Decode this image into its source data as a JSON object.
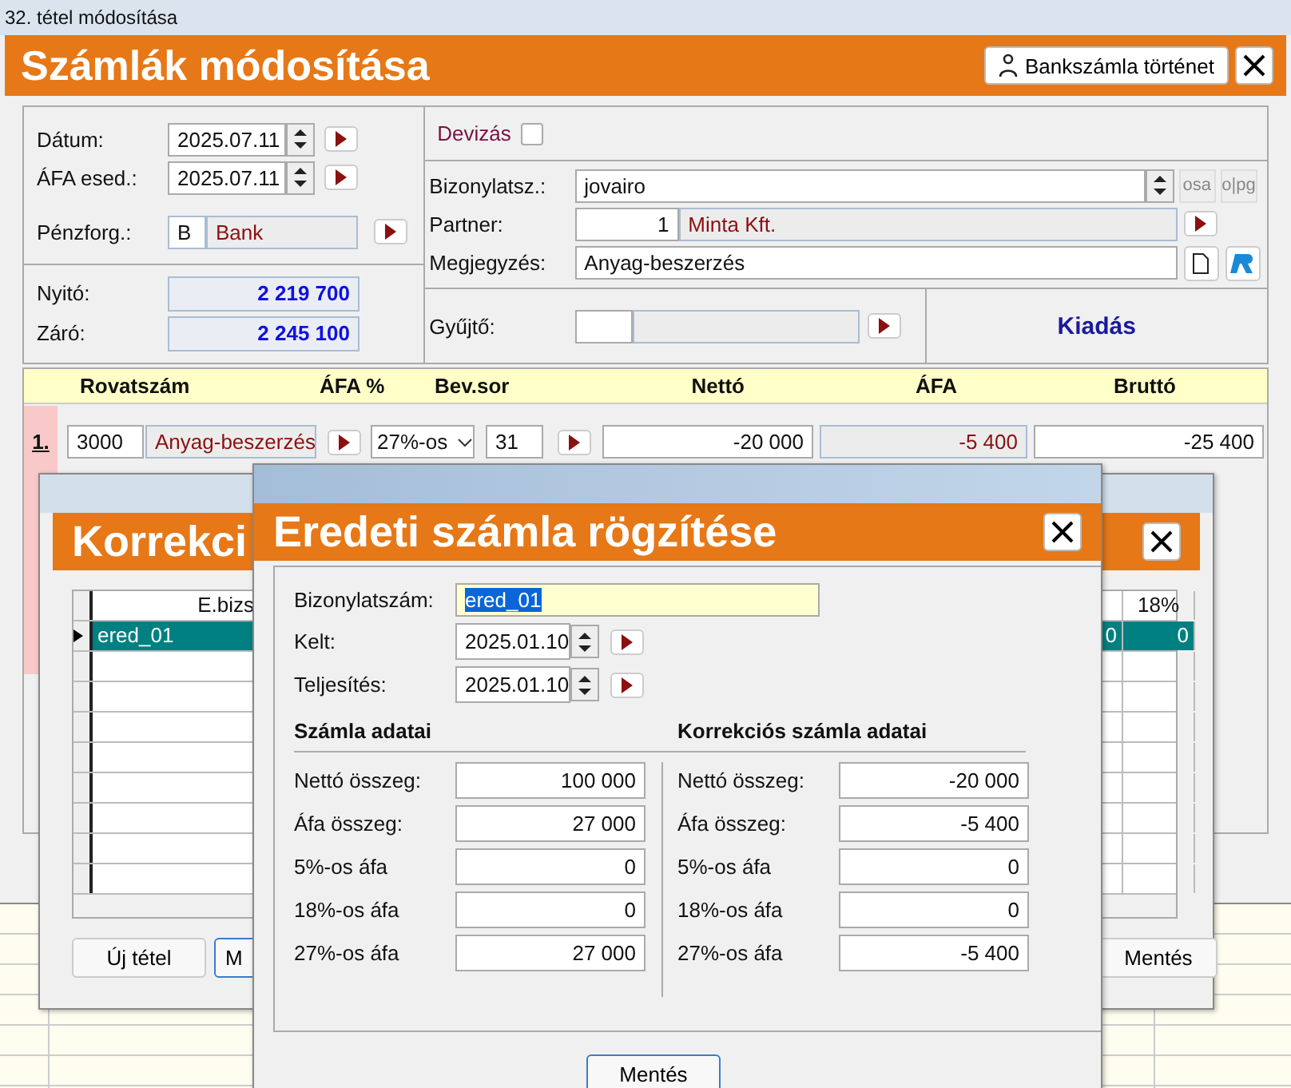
{
  "window": {
    "title": "32. tétel módosítása"
  },
  "header": {
    "title": "Számlák módosítása",
    "history_button": "Bankszámla történet"
  },
  "form": {
    "datum": {
      "label": "Dátum:",
      "value": "2025.07.11"
    },
    "afa_esed": {
      "label": "ÁFA esed.:",
      "value": "2025.07.11"
    },
    "penzforg": {
      "label": "Pénzforg.:",
      "code": "B",
      "name": "Bank"
    },
    "nyito": {
      "label": "Nyitó:",
      "value": "2 219 700"
    },
    "zaro": {
      "label": "Záró:",
      "value": "2 245 100"
    },
    "devizas": {
      "label": "Devizás",
      "checked": false
    },
    "bizonylatsz": {
      "label": "Bizonylatsz.:",
      "value": "jovairo",
      "side_buttons": [
        "osa",
        "o|pg"
      ]
    },
    "partner": {
      "label": "Partner:",
      "code": "1",
      "name": "Minta Kft."
    },
    "megjegyzes": {
      "label": "Megjegyzés:",
      "value": "Anyag-beszerzés"
    },
    "gyujto": {
      "label": "Gyűjtő:"
    },
    "direction": "Kiadás"
  },
  "table": {
    "columns": [
      "Rovatszám",
      "ÁFA %",
      "Bev.sor",
      "Nettó",
      "ÁFA",
      "Bruttó"
    ],
    "rows": [
      {
        "number": "1.",
        "rovat_code": "3000",
        "rovat_name": "Anyag-beszerzés",
        "afa_rate": "27%-os",
        "bev_sor": "31",
        "netto": "-20 000",
        "afa": "-5 400",
        "brutto": "-25 400"
      }
    ]
  },
  "correction_window": {
    "title": "Korrekci",
    "columns": [
      "E.bizs",
      "18%"
    ],
    "rows": [
      {
        "cells": [
          "ered_01",
          "0",
          "0"
        ],
        "selected": true
      }
    ],
    "buttons": [
      "Új tétel",
      "M",
      "Mentés"
    ]
  },
  "dialog": {
    "title": "Eredeti számla rögzítése",
    "bizonylatszam": {
      "label": "Bizonylatszám:",
      "value": "ered_01"
    },
    "kelt": {
      "label": "Kelt:",
      "value": "2025.01.10"
    },
    "teljesites": {
      "label": "Teljesítés:",
      "value": "2025.01.10"
    },
    "original": {
      "title": "Számla adatai",
      "rows": [
        {
          "label": "Nettó összeg:",
          "value": "100 000"
        },
        {
          "label": "Áfa összeg:",
          "value": "27 000"
        },
        {
          "label": "5%-os áfa",
          "value": "0"
        },
        {
          "label": "18%-os áfa",
          "value": "0"
        },
        {
          "label": "27%-os áfa",
          "value": "27 000"
        }
      ]
    },
    "correction": {
      "title": "Korrekciós számla adatai",
      "rows": [
        {
          "label": "Nettó összeg:",
          "value": "-20 000"
        },
        {
          "label": "Áfa összeg:",
          "value": "-5 400"
        },
        {
          "label": "5%-os áfa",
          "value": "0"
        },
        {
          "label": "18%-os áfa",
          "value": "0"
        },
        {
          "label": "27%-os áfa",
          "value": "-5 400"
        }
      ]
    },
    "save_button": "Mentés"
  }
}
